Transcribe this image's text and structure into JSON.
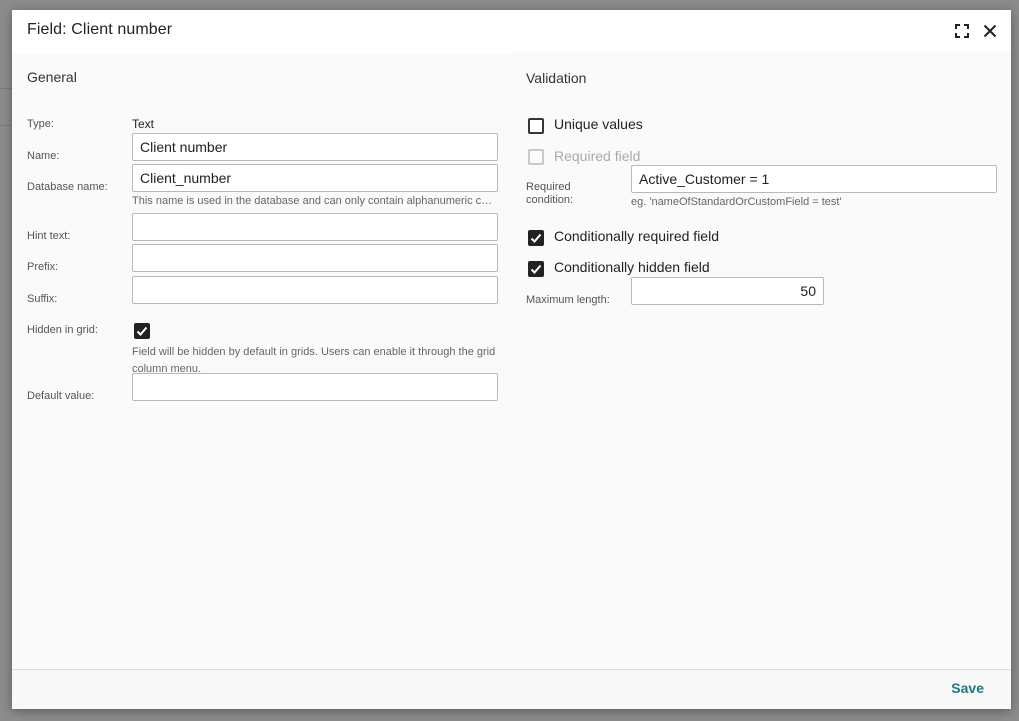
{
  "dialog": {
    "title": "Field: Client number",
    "save_label": "Save"
  },
  "icons": {
    "maximize": "maximize-icon",
    "close": "close-icon",
    "check": "check-icon"
  },
  "general": {
    "title": "General",
    "type_label": "Type:",
    "type_value": "Text",
    "name_label": "Name:",
    "name_value": "Client number",
    "dbname_label": "Database name:",
    "dbname_value": "Client_number",
    "dbname_hint": "This name is used in the database and can only contain alphanumeric char...",
    "hint_label": "Hint text:",
    "hint_value": "",
    "prefix_label": "Prefix:",
    "prefix_value": "",
    "suffix_label": "Suffix:",
    "suffix_value": "",
    "hidden_label": "Hidden in grid:",
    "hidden_checked": true,
    "hidden_hint": "Field will be hidden by default in grids. Users can enable it through the grid column menu.",
    "default_label": "Default value:",
    "default_value": ""
  },
  "validation": {
    "title": "Validation",
    "unique_label": "Unique values",
    "unique_checked": false,
    "required_label": "Required field",
    "required_checked": false,
    "required_disabled": true,
    "condition_label_line1": "Required",
    "condition_label_line2": "condition:",
    "condition_value": "Active_Customer = 1",
    "condition_hint": "eg. 'nameOfStandardOrCustomField = test'",
    "cond_required_label": "Conditionally required field",
    "cond_required_checked": true,
    "cond_hidden_label": "Conditionally hidden field",
    "cond_hidden_checked": true,
    "maxlen_label": "Maximum length:",
    "maxlen_value": "50"
  },
  "colors": {
    "accent": "#1f7a80",
    "backdrop": "#8f8f8f"
  }
}
